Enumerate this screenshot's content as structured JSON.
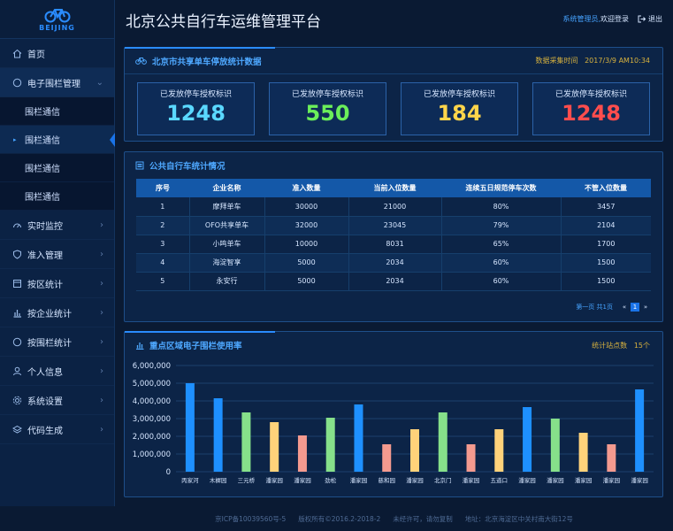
{
  "logo": {
    "text": "BEIJING"
  },
  "header": {
    "title": "北京公共自行车运维管理平台",
    "user_role": "系统管理员,",
    "welcome": "欢迎登录",
    "logout_label": "退出"
  },
  "sidebar": {
    "items": [
      {
        "label": "首页",
        "icon": "home-icon"
      },
      {
        "label": "电子围栏管理",
        "icon": "circle-icon"
      },
      {
        "label": "实时监控",
        "icon": "dashboard-icon"
      },
      {
        "label": "准入管理",
        "icon": "shield-icon"
      },
      {
        "label": "按区统计",
        "icon": "window-icon"
      },
      {
        "label": "按企业统计",
        "icon": "bar-chart-icon"
      },
      {
        "label": "按围栏统计",
        "icon": "circle-icon"
      },
      {
        "label": "个人信息",
        "icon": "user-icon"
      },
      {
        "label": "系统设置",
        "icon": "gear-icon"
      },
      {
        "label": "代码生成",
        "icon": "layers-icon"
      }
    ],
    "subitems": [
      {
        "label": "围栏通信"
      },
      {
        "label": "围栏通信"
      },
      {
        "label": "围栏通信"
      },
      {
        "label": "围栏通信"
      }
    ]
  },
  "stats_panel": {
    "title": "北京市共享单车停放统计数据",
    "time_label": "数据采集时间",
    "time_value": "2017/3/9  AM10:34",
    "cards": [
      {
        "label": "已发放停车授权标识",
        "value": "1248",
        "color": "#5ad8ff"
      },
      {
        "label": "已发放停车授权标识",
        "value": "550",
        "color": "#6bef5a"
      },
      {
        "label": "已发放停车授权标识",
        "value": "184",
        "color": "#ffd54a"
      },
      {
        "label": "已发放停车授权标识",
        "value": "1248",
        "color": "#ff4d4d"
      }
    ]
  },
  "table_panel": {
    "title": "公共自行车统计情况",
    "headers": [
      "序号",
      "企业名称",
      "准入数量",
      "当前入位数量",
      "连续五日规范停车次数",
      "不管入位数量"
    ],
    "rows": [
      [
        "1",
        "摩拜单车",
        "30000",
        "21000",
        "80%",
        "3457"
      ],
      [
        "2",
        "OFO共享单车",
        "32000",
        "23045",
        "79%",
        "2104"
      ],
      [
        "3",
        "小鸣单车",
        "10000",
        "8031",
        "65%",
        "1700"
      ],
      [
        "4",
        "海淀智享",
        "5000",
        "2034",
        "60%",
        "1500"
      ],
      [
        "5",
        "永安行",
        "5000",
        "2034",
        "60%",
        "1500"
      ]
    ],
    "pager_text": "第一页 共1页",
    "current_page": "1"
  },
  "chart_panel": {
    "title": "重点区域电子围栏使用率",
    "count_label": "统计站点数",
    "count_value": "15个"
  },
  "chart_data": {
    "type": "bar",
    "categories": [
      "丙家河",
      "木樨园",
      "三元桥",
      "潘家园",
      "潘家园",
      "劲松",
      "潘家园",
      "慈和园",
      "潘家园",
      "北京门",
      "潘家园",
      "五道口",
      "潘家园",
      "潘家园",
      "潘家园",
      "潘家园",
      "潘家园"
    ],
    "values": [
      5000000,
      4150000,
      3350000,
      2800000,
      2050000,
      3050000,
      3800000,
      1550000,
      2400000,
      3350000,
      1550000,
      2400000,
      3650000,
      3000000,
      2200000,
      1550000,
      4650000
    ],
    "colors": [
      "#1e90ff",
      "#1e90ff",
      "#86e08a",
      "#ffd27a",
      "#f49a8f",
      "#86e08a",
      "#1e90ff",
      "#f49a8f",
      "#ffd27a",
      "#86e08a",
      "#f49a8f",
      "#ffd27a",
      "#1e90ff",
      "#86e08a",
      "#ffd27a",
      "#f49a8f",
      "#1e90ff"
    ],
    "yticks": [
      "0",
      "1,000,000",
      "2,000,000",
      "3,000,000",
      "4,000,000",
      "5,000,000",
      "6,000,000"
    ],
    "ylim": [
      0,
      6000000
    ],
    "grid": true
  },
  "footer": {
    "icp": "京ICP备10039560号-5",
    "copyright": "版权所有©2016.2-2018-2",
    "notice": "未经许可，请勿复制",
    "address": "地址：北京海淀区中关村南大街12号"
  }
}
